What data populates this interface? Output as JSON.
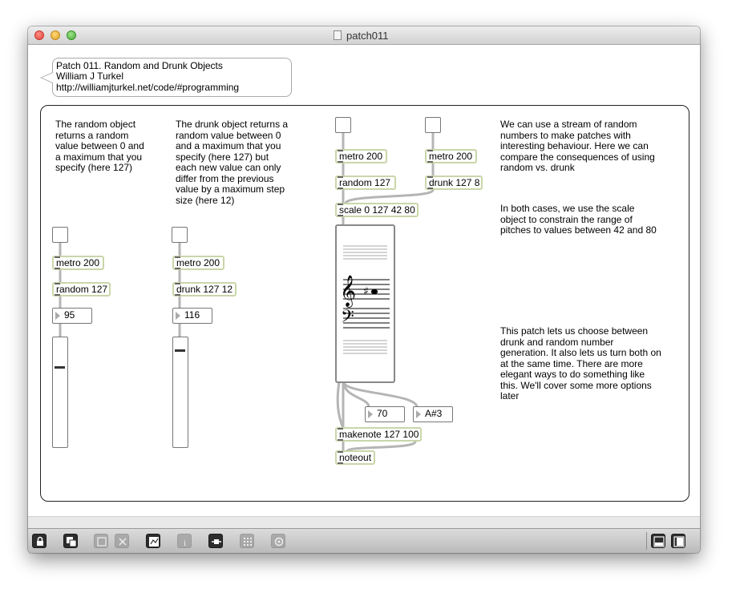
{
  "window": {
    "title": "patch011"
  },
  "header_comment": {
    "line1": "Patch 011. Random and Drunk Objects",
    "line2": "William J Turkel",
    "line3": "http://williamjturkel.net/code/#programming"
  },
  "comments": {
    "random_desc": "The random object\nreturns a random\nvalue between 0 and\na maximum that you\nspecify (here 127)",
    "drunk_desc": "The drunk object returns a\nrandom value between 0\nand a maximum that you\nspecify (here 127) but\neach new value can only\ndiffer from the previous\nvalue by a maximum step\nsize (here 12)",
    "stream_desc": "We can use a stream of random\nnumbers to make patches with\ninteresting behaviour. Here we can\ncompare the consequences of using\nrandom vs. drunk",
    "scale_desc": "In both cases, we use the scale\nobject to constrain the range of\npitches to values between 42 and 80",
    "choose_desc": "This patch lets us choose between\ndrunk and random number\ngeneration. It also lets us turn both on\nat the same time. There are more\nelegant ways to do something like\nthis. We'll cover some more options\nlater"
  },
  "objects": {
    "metro_left": "metro 200",
    "random_left": "random 127",
    "metro_mid": "metro 200",
    "drunk_mid": "drunk 127 12",
    "metro_r1": "metro 200",
    "random_r1": "random 127",
    "metro_r2": "metro 200",
    "drunk_r2": "drunk 127 8",
    "scale": "scale 0 127 42 80",
    "makenote": "makenote 127 100",
    "noteout": "noteout"
  },
  "numbers": {
    "random_value": "95",
    "drunk_value": "116",
    "note_value": "70",
    "note_name": "A#3"
  },
  "sliders": {
    "random_level": 0.75,
    "drunk_level": 0.91
  },
  "toolbar": {
    "items": [
      "lock-icon",
      "presentation-icon",
      "clipboard-icon",
      "delete-icon",
      "inspector-icon",
      "info-icon",
      "object-icon",
      "grid-icon",
      "settings-icon",
      "split-view-icon",
      "single-view-icon"
    ]
  },
  "colors": {
    "object_border": "#c9d6a9",
    "frame": "#222222"
  }
}
